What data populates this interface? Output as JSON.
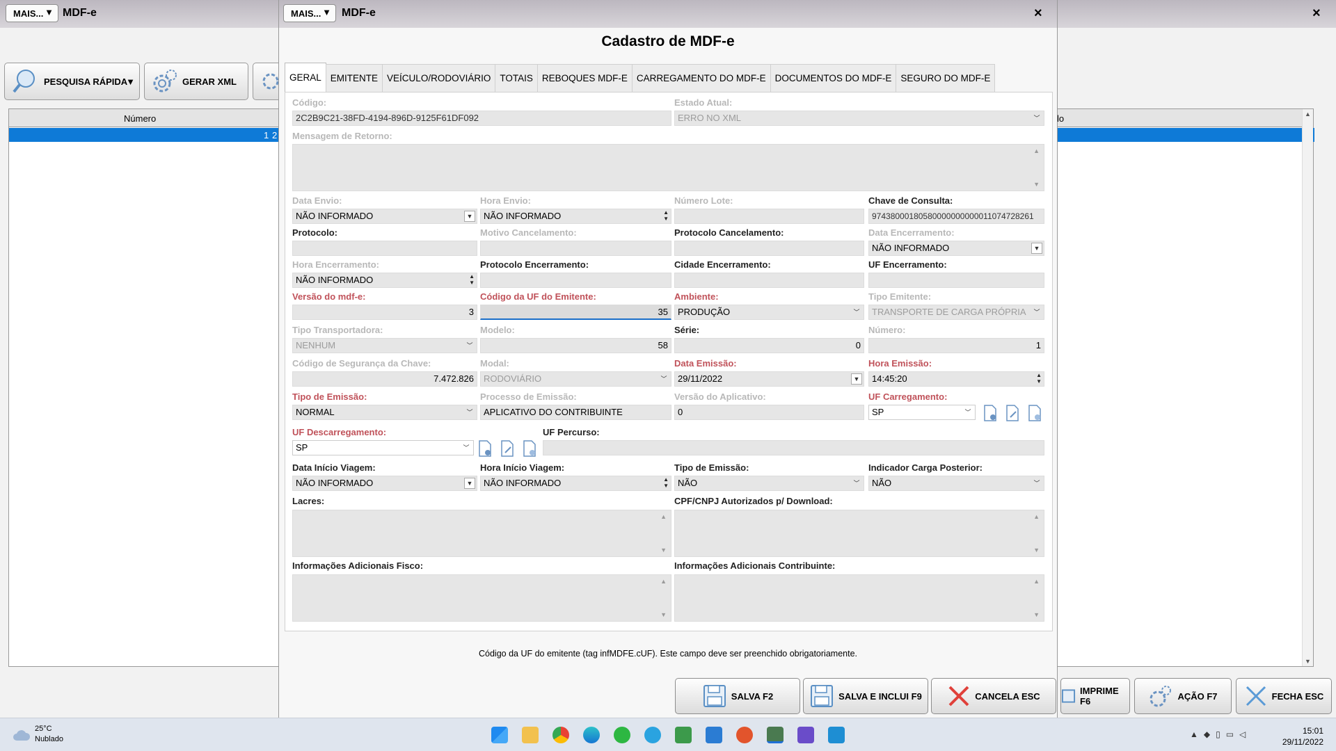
{
  "bg": {
    "mais_label": "MAIS...",
    "mais_arrow": "▼",
    "title": "MDF-e",
    "close": "×",
    "toolbar": {
      "pesquisa": "PESQUISA RÁPIDA",
      "pesquisa_arrow": "▼",
      "gerar_xml": "GERAR XML"
    },
    "grid": {
      "col_numero": "Número",
      "col_right_partial": "lo",
      "row_cells": [
        "1",
        "2"
      ]
    },
    "bottom": {
      "imprime": "IMPRIME F6",
      "acao": "AÇÃO F7",
      "fecha": "FECHA ESC"
    }
  },
  "dialog": {
    "mais_label": "MAIS...",
    "mais_arrow": "▼",
    "title": "MDF-e",
    "close": "×",
    "caption": "Cadastro de MDF-e",
    "tabs": [
      "GERAL",
      "EMITENTE",
      "VEÍCULO/RODOVIÁRIO",
      "TOTAIS",
      "REBOQUES MDF-E",
      "CARREGAMENTO DO MDF-E",
      "DOCUMENTOS DO MDF-E",
      "SEGURO DO MDF-E"
    ],
    "fields": {
      "codigo": {
        "label": "Código:",
        "value": "2C2B9C21-38FD-4194-896D-9125F61DF092"
      },
      "estado_atual": {
        "label": "Estado Atual:",
        "value": "ERRO NO XML"
      },
      "mensagem_retorno": {
        "label": "Mensagem de Retorno:"
      },
      "data_envio": {
        "label": "Data Envio:",
        "value": "NÃO INFORMADO"
      },
      "hora_envio": {
        "label": "Hora Envio:",
        "value": "NÃO INFORMADO"
      },
      "numero_lote": {
        "label": "Número Lote:",
        "value": ""
      },
      "chave_consulta": {
        "label": "Chave de Consulta:",
        "value": "97438000180580000000000011074728261"
      },
      "protocolo": {
        "label": "Protocolo:",
        "value": ""
      },
      "motivo_cancelamento": {
        "label": "Motivo Cancelamento:",
        "value": ""
      },
      "protocolo_cancelamento": {
        "label": "Protocolo Cancelamento:",
        "value": ""
      },
      "data_encerramento": {
        "label": "Data Encerramento:",
        "value": "NÃO INFORMADO"
      },
      "hora_encerramento": {
        "label": "Hora Encerramento:",
        "value": "NÃO INFORMADO"
      },
      "protocolo_encerramento": {
        "label": "Protocolo Encerramento:",
        "value": ""
      },
      "cidade_encerramento": {
        "label": "Cidade Encerramento:",
        "value": ""
      },
      "uf_encerramento": {
        "label": "UF Encerramento:",
        "value": ""
      },
      "versao_mdfe": {
        "label": "Versão do mdf-e:",
        "value": "3"
      },
      "codigo_uf_emitente": {
        "label": "Código da UF do Emitente:",
        "value": "35"
      },
      "ambiente": {
        "label": "Ambiente:",
        "value": "PRODUÇÃO"
      },
      "tipo_emitente": {
        "label": "Tipo Emitente:",
        "value": "TRANSPORTE DE CARGA PRÓPRIA"
      },
      "tipo_transportadora": {
        "label": "Tipo Transportadora:",
        "value": "NENHUM"
      },
      "modelo": {
        "label": "Modelo:",
        "value": "58"
      },
      "serie": {
        "label": "Série:",
        "value": "0"
      },
      "numero": {
        "label": "Número:",
        "value": "1"
      },
      "codigo_seguranca": {
        "label": "Código de Segurança da Chave:",
        "value": "7.472.826"
      },
      "modal": {
        "label": "Modal:",
        "value": "RODOVIÁRIO"
      },
      "data_emissao": {
        "label": "Data Emissão:",
        "value": "29/11/2022"
      },
      "hora_emissao": {
        "label": "Hora Emissão:",
        "value": "14:45:20"
      },
      "tipo_emissao": {
        "label": "Tipo de Emissão:",
        "value": "NORMAL"
      },
      "processo_emissao": {
        "label": "Processo de Emissão:",
        "value": "APLICATIVO DO CONTRIBUINTE"
      },
      "versao_aplicativo": {
        "label": "Versão do Aplicativo:",
        "value": "0"
      },
      "uf_carregamento": {
        "label": "UF Carregamento:",
        "value": "SP"
      },
      "uf_descarregamento": {
        "label": "UF Descarregamento:",
        "value": "SP"
      },
      "uf_percurso": {
        "label": "UF Percurso:",
        "value": ""
      },
      "data_inicio_viagem": {
        "label": "Data Início Viagem:",
        "value": "NÃO INFORMADO"
      },
      "hora_inicio_viagem": {
        "label": "Hora Início Viagem:",
        "value": "NÃO INFORMADO"
      },
      "tipo_emissao2": {
        "label": "Tipo de Emissão:",
        "value": "NÃO"
      },
      "indicador_carga": {
        "label": "Indicador Carga Posterior:",
        "value": "NÃO"
      },
      "lacres": {
        "label": "Lacres:"
      },
      "cpf_cnpj": {
        "label": "CPF/CNPJ Autorizados p/ Download:"
      },
      "info_fisco": {
        "label": "Informações Adicionais Fisco:"
      },
      "info_contribuinte": {
        "label": "Informações Adicionais Contribuinte:"
      }
    },
    "status_message": "Código da UF do emitente (tag infMDFE.cUF). Este campo deve ser preenchido obrigatoriamente.",
    "buttons": {
      "salva": "SALVA F2",
      "salva_inclui": "SALVA E INCLUI F9",
      "cancela": "CANCELA ESC"
    }
  },
  "taskbar": {
    "weather_temp": "25°C",
    "weather_desc": "Nublado",
    "time": "15:01",
    "date": "29/11/2022"
  },
  "colors": {
    "selection": "#0e7ad7",
    "required_label": "#c0525a",
    "cancel_icon": "#e0403a"
  }
}
